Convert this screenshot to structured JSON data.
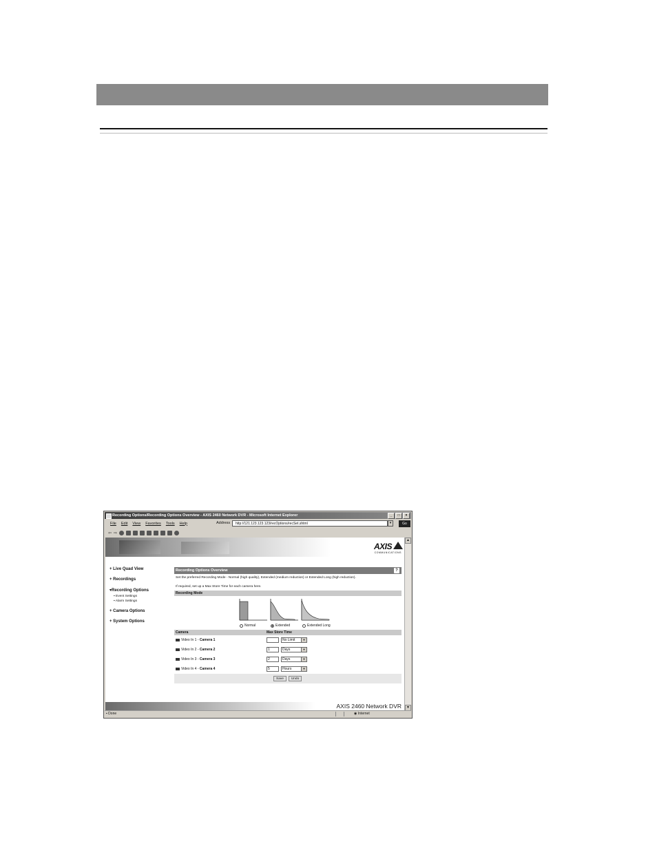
{
  "window": {
    "title": "Recording Options/Recording Options Overview - AXIS 2460 Network DVR - Microsoft Internet Explorer",
    "controls": [
      "_",
      "□",
      "×"
    ]
  },
  "menu": [
    "File",
    "Edit",
    "View",
    "Favorites",
    "Tools",
    "Help"
  ],
  "address": {
    "label": "Address",
    "url": "http://121.123.123.123/recOptions/recSet.shtml",
    "go": "Go"
  },
  "banner": {
    "logo": "AXIS",
    "logo_sub": "COMMUNICATIONS"
  },
  "nav": {
    "items": [
      {
        "label": "Live Quad View"
      },
      {
        "label": "Recordings"
      },
      {
        "label": "Recording Options",
        "sub": [
          "Event Settings",
          "Alarm Settings"
        ]
      },
      {
        "label": "Camera Options"
      },
      {
        "label": "System Options"
      }
    ]
  },
  "content": {
    "title": "Recording Options Overview",
    "help": "?",
    "description": "Set the preferred Recording Mode - Normal (high quality), Extended (medium reduction) or Extended Long (high reduction).",
    "description2": "If required, set up a Max Store Time for each camera here.",
    "mode_header": "Recording Mode",
    "modes": [
      {
        "label": "Normal",
        "selected": false
      },
      {
        "label": "Extended",
        "selected": true
      },
      {
        "label": "Extended Long",
        "selected": false
      }
    ],
    "col_camera": "Camera",
    "col_store": "Max Store Time",
    "cameras": [
      {
        "input": "Video In 1 -",
        "name": "Camera 1",
        "value": "",
        "unit": "No Limit"
      },
      {
        "input": "Video In 2 -",
        "name": "Camera 2",
        "value": "1",
        "unit": "Days"
      },
      {
        "input": "Video In 3 -",
        "name": "Camera 3",
        "value": "2",
        "unit": "Days"
      },
      {
        "input": "Video In 4 -",
        "name": "Camera 4",
        "value": "5",
        "unit": "Hours"
      }
    ],
    "save": "Save",
    "undo": "Undo"
  },
  "footer": {
    "product": "AXIS 2460 Network DVR"
  },
  "status": {
    "left": "Done",
    "zone": "Internet"
  }
}
